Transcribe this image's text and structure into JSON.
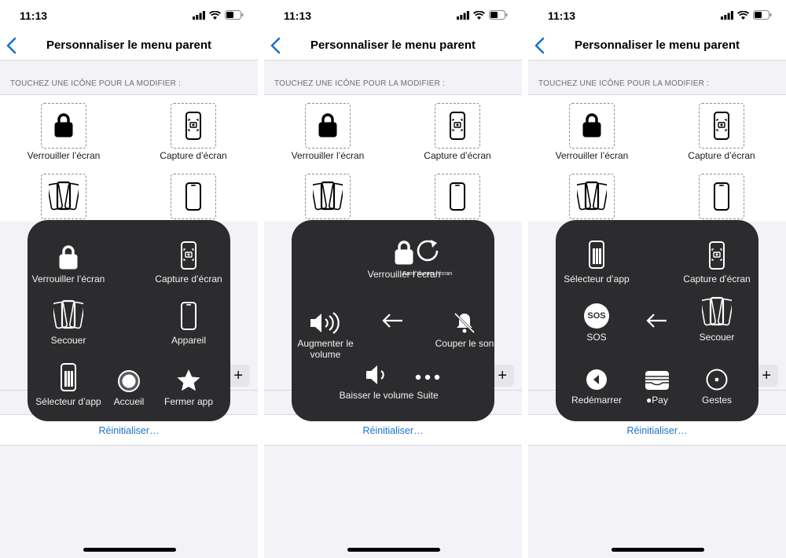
{
  "status": {
    "time": "11:13"
  },
  "screen": {
    "title": "Personnaliser le menu parent",
    "section_header": "TOUCHEZ UNE ICÔNE POUR LA MODIFIER :",
    "grid_items": [
      "Verrouiller l’écran",
      "Capture d’écran"
    ],
    "reset_label": "Réinitialiser…",
    "plus_label": "+"
  },
  "menu1": {
    "items": [
      "Verrouiller l’écran",
      "Capture d’écran",
      "Secouer",
      "Appareil",
      "Sélecteur d’app",
      "Accueil",
      "Fermer app"
    ]
  },
  "menu2": {
    "items": [
      "Verrouiller l’écran",
      "Faire tourner l’écran",
      "Augmenter le volume",
      "Couper le son",
      "Baisser le volume",
      "Suite"
    ]
  },
  "menu3": {
    "items": [
      "Sélecteur d’app",
      "Capture d’écran",
      "SOS",
      "Secouer",
      "Redémarrer",
      "Pay",
      "Gestes"
    ],
    "sos_badge": "SOS"
  },
  "icons": [
    "back-chevron-icon",
    "signal-icon",
    "wifi-icon",
    "battery-icon",
    "lock-icon",
    "screenshot-icon",
    "shake-icon",
    "device-icon",
    "app-switcher-icon",
    "home-icon",
    "star-icon",
    "rotate-icon",
    "volume-up-icon",
    "mute-icon",
    "volume-down-icon",
    "more-icon",
    "back-arrow-icon",
    "sos-icon",
    "restart-icon",
    "wallet-icon",
    "gestures-icon"
  ],
  "colors": {
    "accent": "#1a73c9",
    "menu_bg": "#2c2c2e",
    "background": "#f2f2f7"
  }
}
